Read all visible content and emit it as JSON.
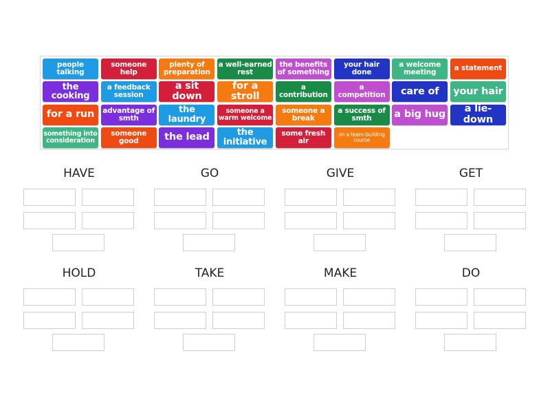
{
  "tiles": [
    {
      "text": "people talking",
      "color": "#1e9be3",
      "size": "s"
    },
    {
      "text": "someone help",
      "color": "#d41f3a",
      "size": "s"
    },
    {
      "text": "plenty of preparation",
      "color": "#f57a10",
      "size": "s"
    },
    {
      "text": "a well-earned rest",
      "color": "#1a8a47",
      "size": "s"
    },
    {
      "text": "the benefits of something",
      "color": "#c04fd0",
      "size": "s"
    },
    {
      "text": "your hair done",
      "color": "#2234c4",
      "size": "s"
    },
    {
      "text": "a welcome meeting",
      "color": "#3db584",
      "size": "s"
    },
    {
      "text": "a statement",
      "color": "#ee4a12",
      "size": "s"
    },
    {
      "text": "the cooking",
      "color": "#7b2fdc",
      "size": "m"
    },
    {
      "text": "a feedback session",
      "color": "#1e9be3",
      "size": "s"
    },
    {
      "text": "a sit down",
      "color": "#d41f3a",
      "size": "l"
    },
    {
      "text": "for a stroll",
      "color": "#f57a10",
      "size": "l"
    },
    {
      "text": "a contribution",
      "color": "#1a8a47",
      "size": "s"
    },
    {
      "text": "a competition",
      "color": "#c04fd0",
      "size": "s"
    },
    {
      "text": "care of",
      "color": "#2234c4",
      "size": "l"
    },
    {
      "text": "your hair",
      "color": "#3db584",
      "size": "l"
    },
    {
      "text": "for a run",
      "color": "#ee4a12",
      "size": "l"
    },
    {
      "text": "advantage of smth",
      "color": "#7b2fdc",
      "size": "s"
    },
    {
      "text": "the laundry",
      "color": "#1e9be3",
      "size": "m"
    },
    {
      "text": "someone a warm welcome",
      "color": "#d41f3a",
      "size": "xs"
    },
    {
      "text": "someone a break",
      "color": "#f57a10",
      "size": "s"
    },
    {
      "text": "a success of smth",
      "color": "#1a8a47",
      "size": "s"
    },
    {
      "text": "a big hug",
      "color": "#c04fd0",
      "size": "l"
    },
    {
      "text": "a lie-down",
      "color": "#2234c4",
      "size": "l"
    },
    {
      "text": "something into consideration",
      "color": "#3db584",
      "size": "xs"
    },
    {
      "text": "someone good",
      "color": "#ee4a12",
      "size": "s"
    },
    {
      "text": "the lead",
      "color": "#7b2fdc",
      "size": "l"
    },
    {
      "text": "the initiative",
      "color": "#1e9be3",
      "size": "m"
    },
    {
      "text": "some fresh air",
      "color": "#d41f3a",
      "size": "s"
    },
    {
      "text": "on a team-building course",
      "color": "#f57a10",
      "size": "xxs"
    }
  ],
  "groups": [
    {
      "title": "HAVE",
      "slots": 5
    },
    {
      "title": "GO",
      "slots": 5
    },
    {
      "title": "GIVE",
      "slots": 5
    },
    {
      "title": "GET",
      "slots": 5
    },
    {
      "title": "HOLD",
      "slots": 5
    },
    {
      "title": "TAKE",
      "slots": 5
    },
    {
      "title": "MAKE",
      "slots": 5
    },
    {
      "title": "DO",
      "slots": 5
    }
  ]
}
